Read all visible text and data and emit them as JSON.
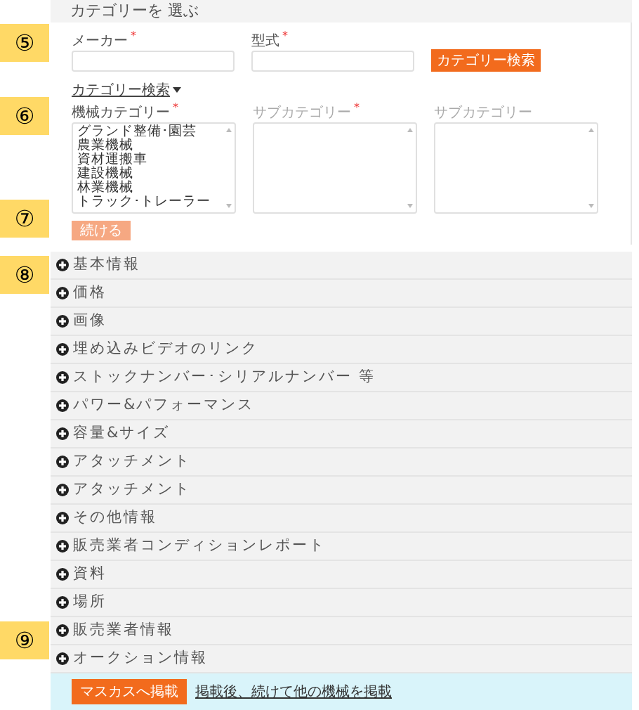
{
  "step_badges": [
    "⑤",
    "⑥",
    "⑦",
    "⑧",
    "⑨"
  ],
  "panel_title": "カテゴリーを 選ぶ",
  "maker": {
    "label": "メーカー",
    "required_mark": "*"
  },
  "model": {
    "label": "型式",
    "required_mark": "*"
  },
  "category_search_button": "カテゴリー検索",
  "category_search_toggle": "カテゴリー検索",
  "category_lists": [
    {
      "label": "機械カテゴリー",
      "required_mark": "*",
      "disabled": false,
      "options": [
        "グランド整備･園芸",
        "農業機械",
        "資材運搬車",
        "建設機械",
        "林業機械",
        "トラック･トレーラー"
      ]
    },
    {
      "label": "サブカテゴリー",
      "required_mark": "*",
      "disabled": true
    },
    {
      "label": "サブカテゴリー",
      "disabled": true
    }
  ],
  "continue_button": {
    "label": "続ける",
    "disabled": true
  },
  "sections": [
    {
      "label": "基本情報",
      "expanded": false
    },
    {
      "label": "価格",
      "expanded": false
    },
    {
      "label": "画像",
      "expanded": false
    },
    {
      "label": "埋め込みビデオのリンク",
      "expanded": false
    },
    {
      "label": "ストックナンバー･シリアルナンバー 等",
      "expanded": false
    },
    {
      "label": "パワー&パフォーマンス",
      "expanded": false
    },
    {
      "label": "容量&サイズ",
      "expanded": false
    },
    {
      "label": "アタッチメント",
      "expanded": false
    },
    {
      "label": "アタッチメント",
      "expanded": false
    },
    {
      "label": "その他情報",
      "expanded": false
    },
    {
      "label": "販売業者コンディションレポート",
      "expanded": false
    },
    {
      "label": "資料",
      "expanded": false
    },
    {
      "label": "場所",
      "expanded": false
    },
    {
      "label": "販売業者情報",
      "expanded": false
    },
    {
      "label": "オークション情報",
      "expanded": false
    }
  ],
  "footer": {
    "publish_button": "マスカスへ掲載",
    "publish_next_link": "掲載後、続けて他の機械を掲載"
  }
}
